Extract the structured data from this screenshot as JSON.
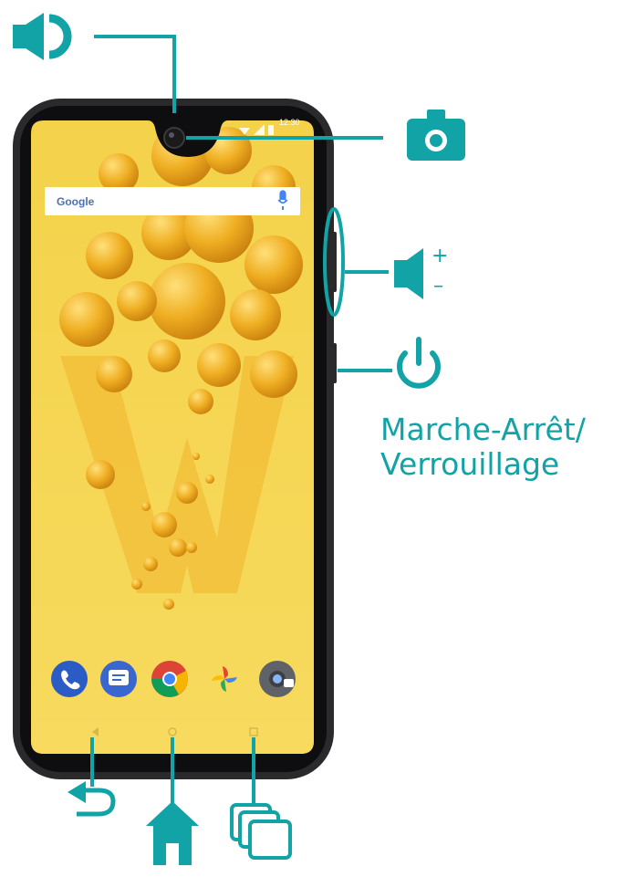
{
  "colors": {
    "accent": "#12A3A6",
    "phone_body": "#1d1d1f",
    "screen_wallpaper": "#F2C83A",
    "ball": "#E7A51C"
  },
  "phone": {
    "search_bar": {
      "logo_text": "Google",
      "mic_icon": "mic-icon"
    },
    "status_bar": {
      "time": "12:30"
    },
    "dock_apps": [
      "phone-app-icon",
      "messages-app-icon",
      "chrome-app-icon",
      "photos-app-icon",
      "camera-app-icon"
    ],
    "nav_bar": [
      "back-nav-icon",
      "home-nav-icon",
      "recents-nav-icon"
    ]
  },
  "callouts": {
    "speaker": {
      "icon": "speaker-icon"
    },
    "camera": {
      "icon": "camera-icon"
    },
    "volume": {
      "icon": "volume-icon",
      "plus": "+",
      "minus": "–"
    },
    "power": {
      "icon": "power-icon",
      "label_line1": "Marche-Arrêt/",
      "label_line2": "Verrouillage"
    },
    "back": {
      "icon": "back-icon"
    },
    "home": {
      "icon": "home-icon"
    },
    "recents": {
      "icon": "recents-icon"
    }
  }
}
